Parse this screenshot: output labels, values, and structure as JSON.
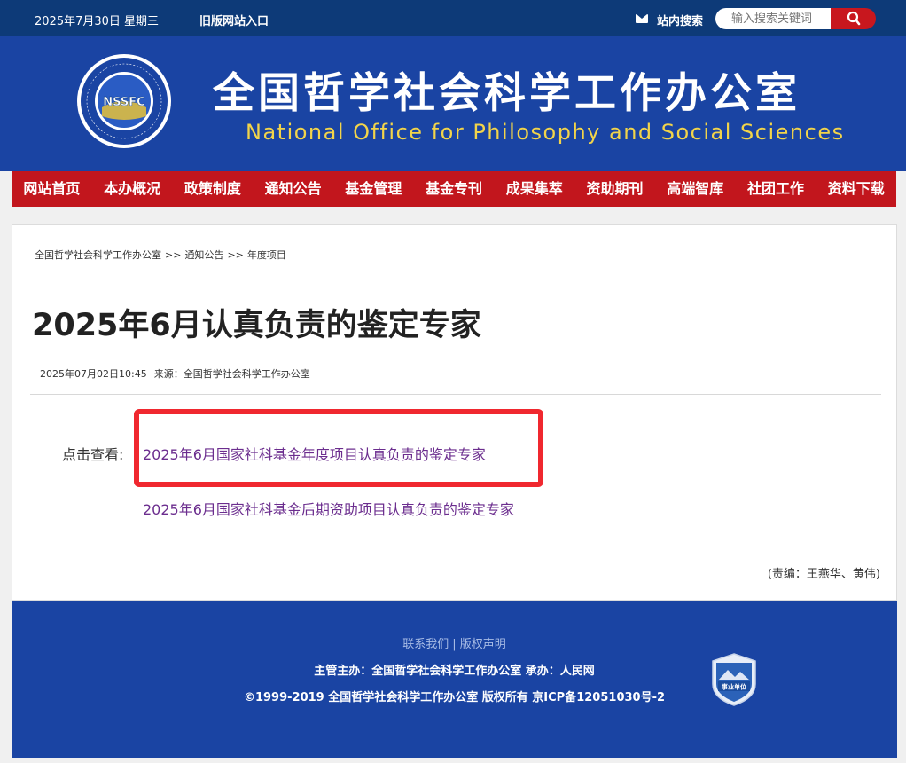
{
  "topbar": {
    "date": "2025年7月30日 星期三",
    "old_site": "旧版网站入口",
    "search_label": "站内搜索",
    "search_placeholder": "输入搜索关键词"
  },
  "banner": {
    "logo_text": "NSSFC",
    "title_cn": "全国哲学社会科学工作办公室",
    "title_en": "National Office for Philosophy and Social Sciences"
  },
  "nav": [
    "网站首页",
    "本办概况",
    "政策制度",
    "通知公告",
    "基金管理",
    "基金专刊",
    "成果集萃",
    "资助期刊",
    "高端智库",
    "社团工作",
    "资料下载"
  ],
  "breadcrumb": {
    "home": "全国哲学社会科学工作办公室",
    "sep": ">>",
    "level1": "通知公告",
    "level2": "年度项目"
  },
  "article": {
    "title": "2025年6月认真负责的鉴定专家",
    "datetime": "2025年07月02日10:45",
    "source": "来源：全国哲学社会科学工作办公室",
    "prefix": "点击查看:",
    "link1": "2025年6月国家社科基金年度项目认真负责的鉴定专家",
    "link2": "2025年6月国家社科基金后期资助项目认真负责的鉴定专家",
    "editor": "(责编：王燕华、黄伟)"
  },
  "footer": {
    "contact": "联系我们",
    "bar": "|",
    "copyright_link": "版权声明",
    "host": "主管主办：全国哲学社会科学工作办公室 承办：人民网",
    "copyright": "©1999-2019 全国哲学社会科学工作办公室 版权所有 京ICP备12051030号-2",
    "badge_text": "事业单位"
  },
  "colors": {
    "topbar": "#0d3a78",
    "banner": "#1a44a3",
    "nav": "#c2161d",
    "link": "#6b2d8e",
    "highlight": "#f0282f",
    "title_en": "#f2d44a"
  }
}
